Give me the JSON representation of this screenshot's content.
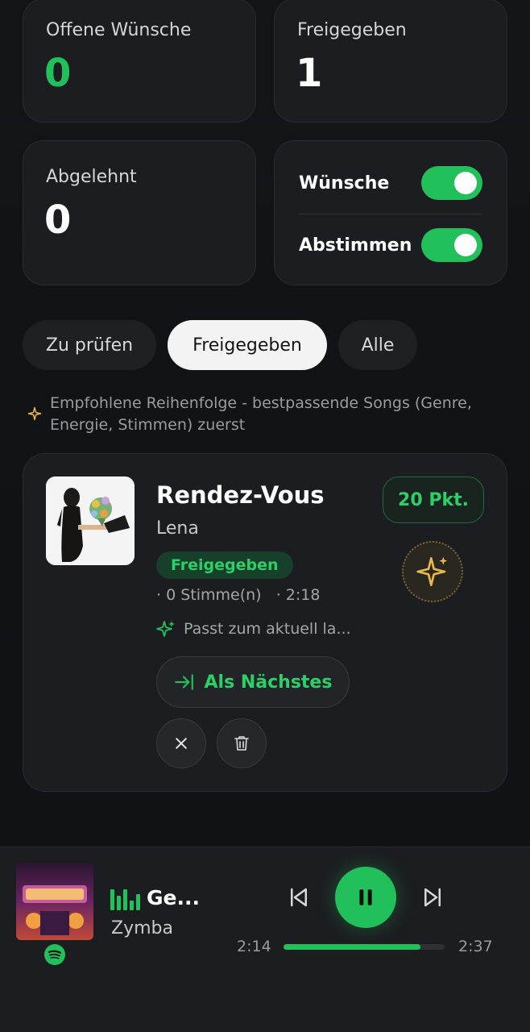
{
  "stats": {
    "open": {
      "label": "Offene Wünsche",
      "value": "0"
    },
    "approved": {
      "label": "Freigegeben",
      "value": "1"
    },
    "rejected": {
      "label": "Abgelehnt",
      "value": "0"
    }
  },
  "toggles": {
    "wishes": {
      "label": "Wünsche",
      "on": true
    },
    "voting": {
      "label": "Abstimmen",
      "on": true
    }
  },
  "tabs": [
    {
      "label": "Zu prüfen",
      "active": false
    },
    {
      "label": "Freigegeben",
      "active": true
    },
    {
      "label": "Alle",
      "active": false
    }
  ],
  "hint": "Empfohlene Reihenfolge - bestpassende Songs (Genre, Energie, Stimmen) zuerst",
  "song": {
    "title": "Rendez-Vous",
    "artist": "Lena",
    "status": "Freigegeben",
    "meta": "· 0 Stimme(n)   · 2:18",
    "match": "Passt zum aktuell la...",
    "points": "20 Pkt.",
    "next_label": "Als Nächstes"
  },
  "player": {
    "title": "Ge...",
    "artist": "Zymba",
    "elapsed": "2:14",
    "duration": "2:37",
    "progress": 0.85
  },
  "colors": {
    "accent": "#22c05a",
    "gold": "#e8b94a",
    "bg": "#111214"
  }
}
